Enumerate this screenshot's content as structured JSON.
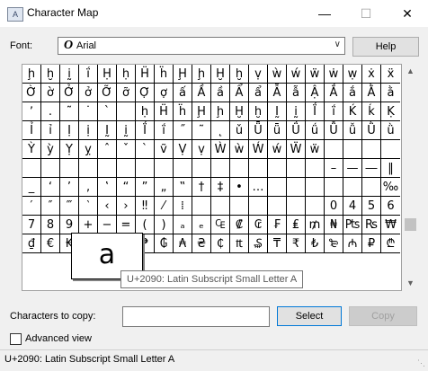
{
  "window": {
    "title": "Character Map",
    "icon_label": "A­",
    "minimize": "—",
    "maximize": "☐",
    "close": "✕"
  },
  "font": {
    "label": "Font:",
    "selected": "Arial",
    "icon": "O",
    "chevron": "∨",
    "help_label": "Help"
  },
  "grid": {
    "rows": [
      [
        "ḩ",
        "ḫ",
        "ḭ",
        "ḯ",
        "Ḥ",
        "ḥ",
        "Ḧ",
        "ḧ",
        "Ḩ",
        "ḩ",
        "Ḫ",
        "ḫ",
        "ṿ",
        "ẁ",
        "ẃ",
        "ẅ",
        "ẇ",
        "ẉ",
        "ẋ",
        "ẍ"
      ],
      [
        "Ờ",
        "ờ",
        "Ở",
        "ở",
        "Ỡ",
        "ỡ",
        "Ợ",
        "ợ",
        "ấ",
        "Ầ",
        "ầ",
        "Ẩ",
        "ẩ",
        "Ẫ",
        "ẫ",
        "Ậ",
        "Ắ",
        "ắ",
        "Ằ",
        "ằ"
      ],
      [
        "ʼ",
        ".",
        "˜",
        "˙",
        "`",
        "",
        "ḥ",
        "Ḧ",
        "ḧ",
        "Ḩ",
        "ḩ",
        "Ḫ",
        "ḫ",
        "Ḭ",
        "ḭ",
        "Ḯ",
        "ḯ",
        "Ḱ",
        "ḱ",
        "Ḳ"
      ],
      [
        "Ỉ",
        "ỉ",
        "Ị",
        "ị",
        "Ḭ",
        "ḭ",
        "Ḯ",
        "ḯ",
        "˝",
        "˜",
        "˛",
        "ǔ",
        "Ǖ",
        "ǖ",
        "Ǘ",
        "ǘ",
        "Ǚ",
        "ǚ",
        "Ǜ",
        "ǜ"
      ],
      [
        "Ỳ",
        "ỳ",
        "Ỵ",
        "ỵ",
        "ˆ",
        "ˇ",
        "ˋ",
        "ṽ",
        "Ṿ",
        "ṿ",
        "Ẁ",
        "ẁ",
        "Ẃ",
        "ẃ",
        "Ẅ",
        "ẅ",
        "",
        "",
        "",
        ""
      ],
      [
        "",
        "",
        "",
        "",
        "",
        "",
        "",
        "",
        "",
        "",
        "",
        "",
        "",
        "",
        "",
        "",
        "–",
        "—",
        "―",
        "‖"
      ],
      [
        "_",
        "‘",
        "’",
        "‚",
        "‛",
        "“",
        "”",
        "„",
        "‟",
        "†",
        "‡",
        "•",
        "…",
        "",
        "",
        "",
        "",
        "",
        "",
        "‰"
      ],
      [
        "′",
        "″",
        "‴",
        "‵",
        "‹",
        "›",
        "‼",
        "⁄",
        "⁞",
        "",
        "",
        "",
        "",
        "",
        "",
        "",
        "0",
        "4",
        "5",
        "6"
      ],
      [
        "7",
        "8",
        "9",
        "+",
        "−",
        "=",
        "(",
        ")",
        "ₐ",
        "ₑ",
        "₠",
        "₡",
        "₢",
        "₣",
        "₤",
        "₥",
        "₦",
        "₧",
        "₨",
        "₩"
      ],
      [
        "₫",
        "€",
        "₭",
        "₮",
        "₯",
        "₰",
        "₱",
        "₲",
        "₳",
        "₴",
        "₵",
        "₶",
        "₷",
        "₸",
        "₹",
        "₺",
        "₻",
        "₼",
        "₽",
        "₾"
      ]
    ],
    "magnified": "a"
  },
  "tooltip": "U+2090: Latin Subscript Small Letter A",
  "copy": {
    "label": "Characters to copy:",
    "value": "",
    "select_label": "Select",
    "copy_label": "Copy"
  },
  "advanced": {
    "label": "Advanced view",
    "checked": false
  },
  "status": {
    "text": "U+2090: Latin Subscript Small Letter A"
  },
  "scroll": {
    "up": "▲",
    "down": "▼"
  }
}
